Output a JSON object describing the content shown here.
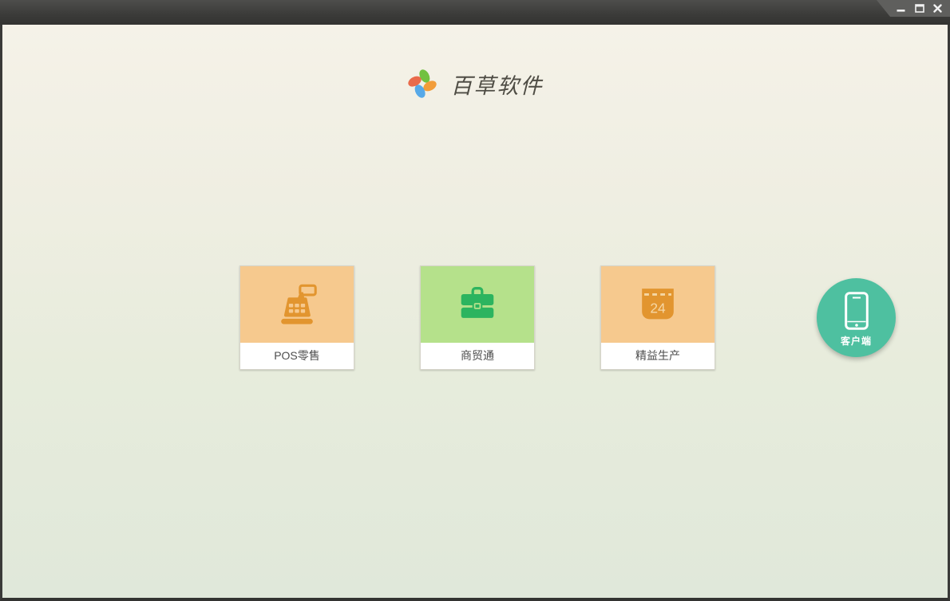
{
  "window": {
    "controls": {
      "minimize": "minimize",
      "maximize": "maximize",
      "close": "close"
    },
    "titlebar_color": "#3c3c3a"
  },
  "header": {
    "app_name": "百草软件",
    "logo_petal_colors": {
      "top": "#72c13f",
      "right": "#f29d3a",
      "bottom": "#57a9e8",
      "left": "#e96b4b"
    }
  },
  "products": [
    {
      "label": "POS零售",
      "icon": "cash-register-icon",
      "tile_bg": "#f6c98e",
      "icon_color": "#e2952f"
    },
    {
      "label": "商贸通",
      "icon": "briefcase-icon",
      "tile_bg": "#b5e18b",
      "icon_color": "#2cb45f"
    },
    {
      "label": "精益生产",
      "icon": "calendar-icon",
      "tile_bg": "#f6c98e",
      "icon_color": "#e2952f",
      "calendar_day": "24",
      "calendar_accent": "#f5d7a5"
    }
  ],
  "client_button": {
    "label": "客户端",
    "icon": "smartphone-icon",
    "bg": "#4ec0a0"
  },
  "theme": {
    "content_top": "#f5f2e8",
    "content_bottom": "#e0e8da",
    "label_text": "#4d4d4d"
  }
}
